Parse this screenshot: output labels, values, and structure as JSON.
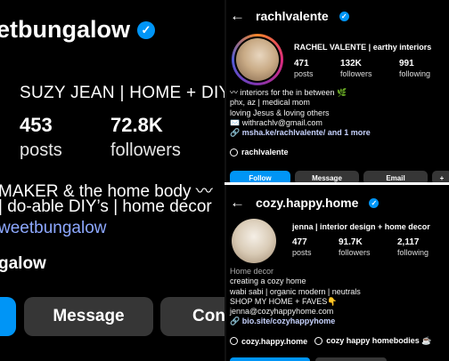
{
  "left": {
    "handle": "etbungalow",
    "full_name": "SUZY JEAN | HOME + DIY",
    "stats": [
      {
        "num": "453",
        "label": "posts"
      },
      {
        "num": "72.8K",
        "label": "followers"
      }
    ],
    "bio_line1": "MAKER & the home body 〰",
    "bio_line2": "| do-able DIY’s | home decor",
    "bio_link": "weetbungalow",
    "threads": "galow",
    "buttons": {
      "message": "Message",
      "contact": "Con"
    }
  },
  "top_right": {
    "back": "←",
    "handle": "rachlvalente",
    "name": "RACHEL VALENTE | earthy interiors",
    "stats": [
      {
        "num": "471",
        "label": "posts"
      },
      {
        "num": "132K",
        "label": "followers"
      },
      {
        "num": "991",
        "label": "following"
      }
    ],
    "bio": [
      "〰 interiors for the in between 🌿",
      "phx, az | medical mom",
      "loving Jesus & loving others",
      "✉️ withrachlv@gmail.com"
    ],
    "link": "msha.ke/rachlvalente/ and 1 more",
    "threads": "rachlvalente",
    "buttons": {
      "follow": "Follow",
      "message": "Message",
      "email": "Email"
    }
  },
  "bottom_right": {
    "back": "←",
    "handle": "cozy.happy.home",
    "name": "jenna | interior design + home decor",
    "stats": [
      {
        "num": "477",
        "label": "posts"
      },
      {
        "num": "91.7K",
        "label": "followers"
      },
      {
        "num": "2,117",
        "label": "following"
      }
    ],
    "category": "Home decor",
    "bio": [
      "creating a cozy home",
      "wabi sabi | organic modern | neutrals",
      "SHOP MY HOME + FAVES👇",
      "jenna@cozyhappyhome.com"
    ],
    "link": "bio.site/cozyhappyhome",
    "threads": "cozy.happy.home",
    "threads2": "cozy happy homebodies ☕"
  },
  "colors": {
    "accent": "#0095f6",
    "button": "#363636",
    "link": "#8da8ff"
  }
}
